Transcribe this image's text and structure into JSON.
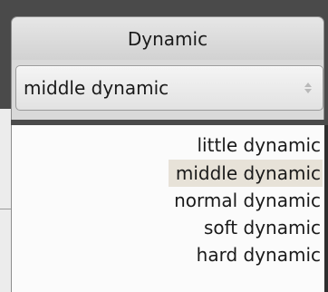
{
  "panel": {
    "title": "Dynamic"
  },
  "dropdown": {
    "selected": "middle dynamic",
    "icon": "stepper-arrows-icon"
  },
  "options": [
    {
      "label": "little dynamic",
      "selected": false
    },
    {
      "label": "middle dynamic",
      "selected": true
    },
    {
      "label": "normal dynamic",
      "selected": false
    },
    {
      "label": "soft dynamic",
      "selected": false
    },
    {
      "label": "hard dynamic",
      "selected": false
    }
  ],
  "colors": {
    "background_dark": "#4a4a4a",
    "selected_highlight": "#e7e2d8",
    "header_background": "#dcdcdc",
    "list_background": "#fbfbfb"
  }
}
